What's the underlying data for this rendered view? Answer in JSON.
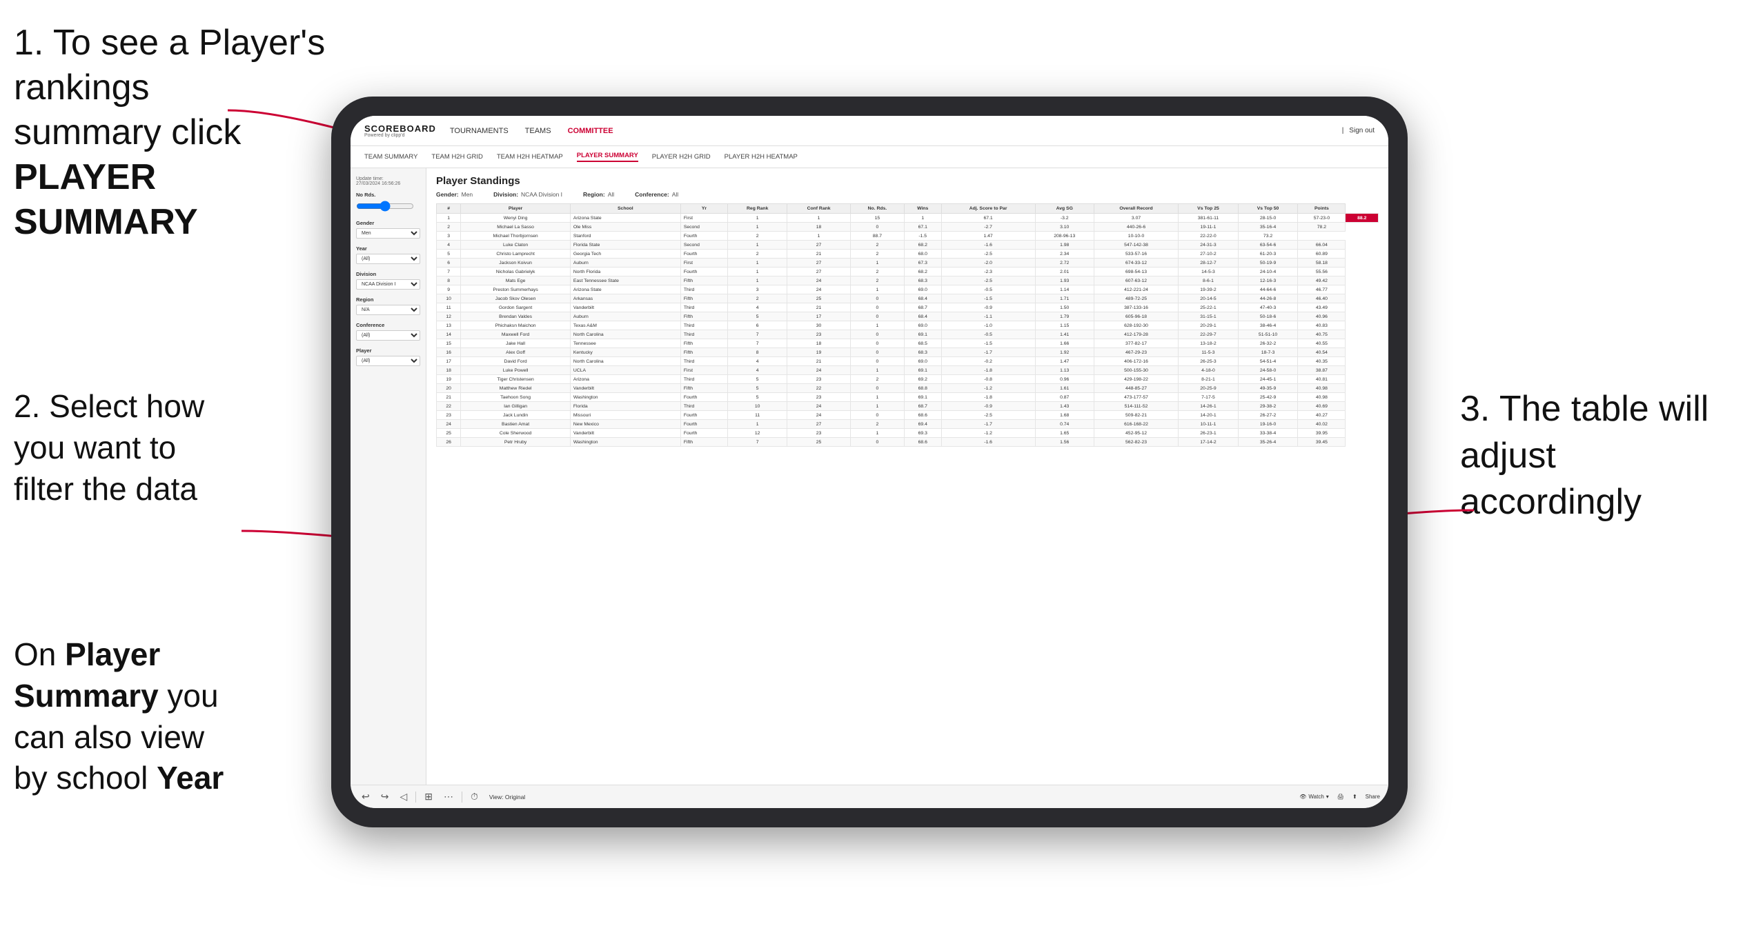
{
  "instructions": {
    "step1_line1": "1. To see a Player's rankings",
    "step1_line2": "summary click ",
    "step1_bold": "PLAYER SUMMARY",
    "step2_line1": "2. Select how",
    "step2_line2": "you want to",
    "step2_line3": "filter the data",
    "step3_line1": "3. The table will",
    "step3_line2": "adjust accordingly",
    "sub_line1": "On ",
    "sub_bold1": "Player",
    "sub_line2": "Summary",
    "sub_rest": " you can also view by school ",
    "sub_bold2": "Year"
  },
  "nav": {
    "logo": "SCOREBOARD",
    "powered": "Powered by clipp'd",
    "links": [
      "TOURNAMENTS",
      "TEAMS",
      "COMMITTEE"
    ],
    "sign_out": "Sign out"
  },
  "sub_nav": {
    "links": [
      "TEAM SUMMARY",
      "TEAM H2H GRID",
      "TEAM H2H HEATMAP",
      "PLAYER SUMMARY",
      "PLAYER H2H GRID",
      "PLAYER H2H HEATMAP"
    ]
  },
  "sidebar": {
    "update_label": "Update time:",
    "update_value": "27/03/2024 16:56:26",
    "no_rds_label": "No Rds.",
    "gender_label": "Gender",
    "gender_value": "Men",
    "year_label": "Year",
    "year_value": "(All)",
    "division_label": "Division",
    "division_value": "NCAA Division I",
    "region_label": "Region",
    "region_value": "N/A",
    "conference_label": "Conference",
    "conference_value": "(All)",
    "player_label": "Player",
    "player_value": "(All)"
  },
  "table": {
    "title": "Player Standings",
    "filters": {
      "gender_label": "Gender:",
      "gender_value": "Men",
      "division_label": "Division:",
      "division_value": "NCAA Division I",
      "region_label": "Region:",
      "region_value": "All",
      "conference_label": "Conference:",
      "conference_value": "All"
    },
    "headers": [
      "#",
      "Player",
      "School",
      "Yr",
      "Reg Rank",
      "Conf Rank",
      "No. Rds.",
      "Wins",
      "Adj. Score to Par",
      "Avg SG",
      "Overall Record",
      "Vs Top 25",
      "Vs Top 50",
      "Points"
    ],
    "rows": [
      [
        "1",
        "Wenyi Ding",
        "Arizona State",
        "First",
        "1",
        "1",
        "15",
        "1",
        "67.1",
        "-3.2",
        "3.07",
        "381-61-11",
        "28-15-0",
        "57-23-0",
        "88.2"
      ],
      [
        "2",
        "Michael La Sasso",
        "Ole Miss",
        "Second",
        "1",
        "18",
        "0",
        "67.1",
        "-2.7",
        "3.10",
        "440-26-6",
        "19-11-1",
        "35-16-4",
        "78.2"
      ],
      [
        "3",
        "Michael Thorbjornsen",
        "Stanford",
        "Fourth",
        "2",
        "1",
        "88.7",
        "-1.5",
        "1.47",
        "208-96-13",
        "10-10-0",
        "22-22-0",
        "73.2"
      ],
      [
        "4",
        "Luke Claton",
        "Florida State",
        "Second",
        "1",
        "27",
        "2",
        "68.2",
        "-1.6",
        "1.98",
        "547-142-38",
        "24-31-3",
        "63-54-6",
        "66.04"
      ],
      [
        "5",
        "Christo Lamprecht",
        "Georgia Tech",
        "Fourth",
        "2",
        "21",
        "2",
        "68.0",
        "-2.5",
        "2.34",
        "533-57-16",
        "27-10-2",
        "61-20-3",
        "60.89"
      ],
      [
        "6",
        "Jackson Koivun",
        "Auburn",
        "First",
        "1",
        "27",
        "1",
        "67.3",
        "-2.0",
        "2.72",
        "674-33-12",
        "28-12-7",
        "50-19-9",
        "58.18"
      ],
      [
        "7",
        "Nicholas Gabrielyk",
        "North Florida",
        "Fourth",
        "1",
        "27",
        "2",
        "68.2",
        "-2.3",
        "2.01",
        "698-54-13",
        "14-5-3",
        "24-10-4",
        "55.56"
      ],
      [
        "8",
        "Mats Ege",
        "East Tennessee State",
        "Fifth",
        "1",
        "24",
        "2",
        "68.3",
        "-2.5",
        "1.93",
        "607-63-12",
        "8-6-1",
        "12-16-3",
        "49.42"
      ],
      [
        "9",
        "Preston Summerhays",
        "Arizona State",
        "Third",
        "3",
        "24",
        "1",
        "69.0",
        "-0.5",
        "1.14",
        "412-221-24",
        "19-39-2",
        "44-64-6",
        "46.77"
      ],
      [
        "10",
        "Jacob Skov Olesen",
        "Arkansas",
        "Fifth",
        "2",
        "25",
        "0",
        "68.4",
        "-1.5",
        "1.71",
        "489-72-25",
        "20-14-5",
        "44-26-8",
        "46.40"
      ],
      [
        "11",
        "Gordon Sargent",
        "Vanderbilt",
        "Third",
        "4",
        "21",
        "0",
        "68.7",
        "-0.9",
        "1.50",
        "387-133-16",
        "25-22-1",
        "47-40-3",
        "43.49"
      ],
      [
        "12",
        "Brendan Valdes",
        "Auburn",
        "Fifth",
        "5",
        "17",
        "0",
        "68.4",
        "-1.1",
        "1.79",
        "605-96-18",
        "31-15-1",
        "50-18-6",
        "40.96"
      ],
      [
        "13",
        "Phichaksn Maichon",
        "Texas A&M",
        "Third",
        "6",
        "30",
        "1",
        "69.0",
        "-1.0",
        "1.15",
        "628-192-30",
        "20-29-1",
        "38-46-4",
        "40.83"
      ],
      [
        "14",
        "Maxwell Ford",
        "North Carolina",
        "Third",
        "7",
        "23",
        "0",
        "69.1",
        "-0.5",
        "1.41",
        "412-179-28",
        "22-29-7",
        "51-51-10",
        "40.75"
      ],
      [
        "15",
        "Jake Hall",
        "Tennessee",
        "Fifth",
        "7",
        "18",
        "0",
        "68.5",
        "-1.5",
        "1.66",
        "377-82-17",
        "13-18-2",
        "26-32-2",
        "40.55"
      ],
      [
        "16",
        "Alex Goff",
        "Kentucky",
        "Fifth",
        "8",
        "19",
        "0",
        "68.3",
        "-1.7",
        "1.92",
        "467-29-23",
        "11-5-3",
        "18-7-3",
        "40.54"
      ],
      [
        "17",
        "David Ford",
        "North Carolina",
        "Third",
        "4",
        "21",
        "0",
        "69.0",
        "-0.2",
        "1.47",
        "406-172-16",
        "26-25-3",
        "54-51-4",
        "40.35"
      ],
      [
        "18",
        "Luke Powell",
        "UCLA",
        "First",
        "4",
        "24",
        "1",
        "69.1",
        "-1.8",
        "1.13",
        "500-155-30",
        "4-18-0",
        "24-58-0",
        "38.87"
      ],
      [
        "19",
        "Tiger Christensen",
        "Arizona",
        "Third",
        "5",
        "23",
        "2",
        "69.2",
        "-0.8",
        "0.96",
        "429-198-22",
        "8-21-1",
        "24-45-1",
        "40.81"
      ],
      [
        "20",
        "Matthew Riedel",
        "Vanderbilt",
        "Fifth",
        "5",
        "22",
        "0",
        "68.8",
        "-1.2",
        "1.61",
        "448-85-27",
        "20-25-9",
        "49-35-9",
        "40.98"
      ],
      [
        "21",
        "Taehoon Song",
        "Washington",
        "Fourth",
        "5",
        "23",
        "1",
        "69.1",
        "-1.8",
        "0.87",
        "473-177-57",
        "7-17-5",
        "25-42-9",
        "40.98"
      ],
      [
        "22",
        "Ian Gilligan",
        "Florida",
        "Third",
        "10",
        "24",
        "1",
        "68.7",
        "-0.9",
        "1.43",
        "514-111-52",
        "14-26-1",
        "29-38-2",
        "40.69"
      ],
      [
        "23",
        "Jack Lundin",
        "Missouri",
        "Fourth",
        "11",
        "24",
        "0",
        "68.6",
        "-2.5",
        "1.68",
        "509-82-21",
        "14-20-1",
        "26-27-2",
        "40.27"
      ],
      [
        "24",
        "Bastien Amat",
        "New Mexico",
        "Fourth",
        "1",
        "27",
        "2",
        "69.4",
        "-1.7",
        "0.74",
        "616-168-22",
        "10-11-1",
        "19-16-0",
        "40.02"
      ],
      [
        "25",
        "Cole Sherwood",
        "Vanderbilt",
        "Fourth",
        "12",
        "23",
        "1",
        "69.3",
        "-1.2",
        "1.65",
        "452-95-12",
        "26-23-1",
        "33-38-4",
        "39.95"
      ],
      [
        "26",
        "Petr Hruby",
        "Washington",
        "Fifth",
        "7",
        "25",
        "0",
        "68.6",
        "-1.6",
        "1.56",
        "562-82-23",
        "17-14-2",
        "35-26-4",
        "39.45"
      ]
    ]
  },
  "toolbar": {
    "view_label": "View: Original",
    "watch_label": "Watch",
    "share_label": "Share"
  }
}
